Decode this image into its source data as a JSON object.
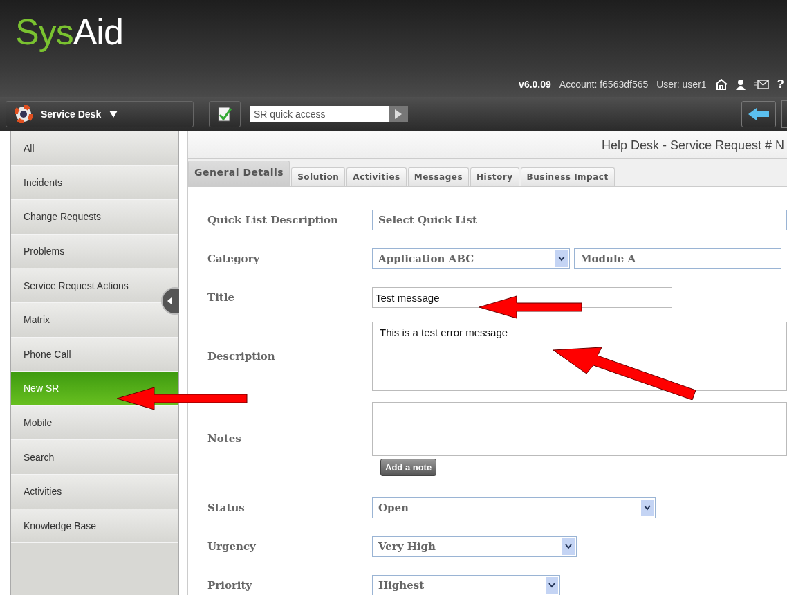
{
  "header": {
    "logo": [
      "Sys",
      "Aid"
    ],
    "version": "v6.0.09",
    "account": "Account: f6563df565",
    "user": "User: user1",
    "help": "?"
  },
  "toolbar": {
    "module": "Service Desk",
    "quick_access": {
      "placeholder": "SR quick access"
    }
  },
  "sidebar": {
    "items": [
      {
        "label": "All",
        "selected": false
      },
      {
        "label": "Incidents",
        "selected": false
      },
      {
        "label": "Change Requests",
        "selected": false
      },
      {
        "label": "Problems",
        "selected": false
      },
      {
        "label": "Service Request Actions",
        "selected": false
      },
      {
        "label": "Matrix",
        "selected": false
      },
      {
        "label": "Phone Call",
        "selected": false
      },
      {
        "label": "New SR",
        "selected": true
      },
      {
        "label": "Mobile",
        "selected": false
      },
      {
        "label": "Search",
        "selected": false
      },
      {
        "label": "Activities",
        "selected": false
      },
      {
        "label": "Knowledge Base",
        "selected": false
      }
    ]
  },
  "page_title": "Help Desk - Service Request # N",
  "tabs": [
    {
      "label": "General Details",
      "selected": true
    },
    {
      "label": "Solution",
      "selected": false
    },
    {
      "label": "Activities",
      "selected": false
    },
    {
      "label": "Messages",
      "selected": false
    },
    {
      "label": "History",
      "selected": false
    },
    {
      "label": "Business Impact",
      "selected": false
    }
  ],
  "form": [
    {
      "label": "Quick List Description",
      "kind": "text",
      "value": "Select Quick List"
    },
    {
      "label": "Category",
      "kind": "pair",
      "value": "Application ABC",
      "value2": "Module A"
    },
    {
      "label": "Title",
      "kind": "input",
      "value": "Test message"
    },
    {
      "label": "Description",
      "kind": "textarea",
      "value": "This is a test error message"
    },
    {
      "label": "Notes",
      "kind": "notes",
      "button": "Add a note"
    },
    {
      "label": "Status",
      "kind": "select",
      "value": "Open"
    },
    {
      "label": "Urgency",
      "kind": "select",
      "value": "Very High"
    },
    {
      "label": "Priority",
      "kind": "select",
      "value": "Highest"
    }
  ]
}
